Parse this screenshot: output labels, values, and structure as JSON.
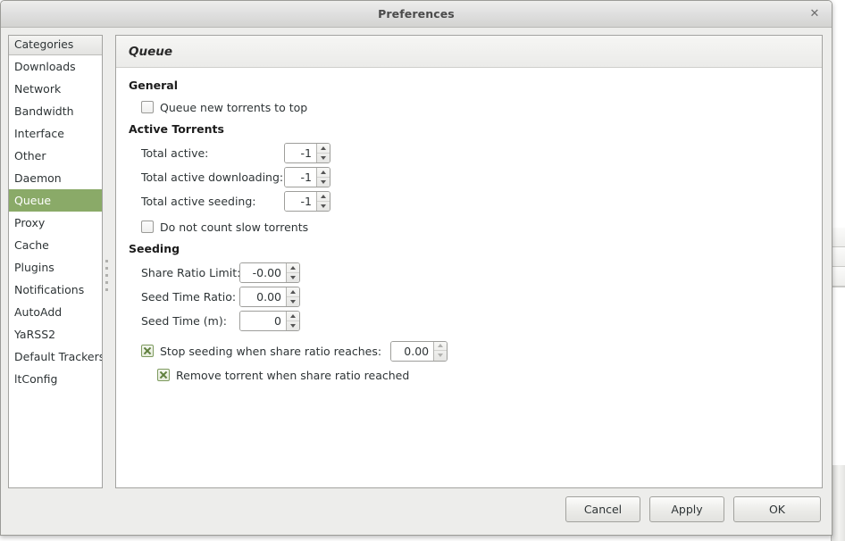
{
  "window": {
    "title": "Preferences",
    "close_label": "✕"
  },
  "sidebar": {
    "header": "Categories",
    "selected": "Queue",
    "accent_color": "#8aaa68",
    "items": [
      {
        "label": "Downloads"
      },
      {
        "label": "Network"
      },
      {
        "label": "Bandwidth"
      },
      {
        "label": "Interface"
      },
      {
        "label": "Other"
      },
      {
        "label": "Daemon"
      },
      {
        "label": "Queue"
      },
      {
        "label": "Proxy"
      },
      {
        "label": "Cache"
      },
      {
        "label": "Plugins"
      },
      {
        "label": "Notifications"
      },
      {
        "label": "AutoAdd"
      },
      {
        "label": "YaRSS2"
      },
      {
        "label": "Default Trackers"
      },
      {
        "label": "ltConfig"
      }
    ]
  },
  "main": {
    "header_title": "Queue",
    "general": {
      "title": "General",
      "queue_new_to_top": {
        "label": "Queue new torrents to top",
        "checked": false
      }
    },
    "active_torrents": {
      "title": "Active Torrents",
      "rows": [
        {
          "label": "Total active:",
          "value": "-1"
        },
        {
          "label": "Total active downloading:",
          "value": "-1"
        },
        {
          "label": "Total active seeding:",
          "value": "-1"
        }
      ],
      "do_not_count_slow": {
        "label": "Do not count slow torrents",
        "checked": false
      }
    },
    "seeding": {
      "title": "Seeding",
      "rows": [
        {
          "label": "Share Ratio Limit:",
          "value": "-0.00"
        },
        {
          "label": "Seed Time Ratio:",
          "value": "0.00"
        },
        {
          "label": "Seed Time (m):",
          "value": "0"
        }
      ],
      "stop_seeding": {
        "label": "Stop seeding when share ratio reaches:",
        "checked": true,
        "value": "0.00"
      },
      "remove_torrent": {
        "label": "Remove torrent when share ratio reached",
        "checked": true
      }
    }
  },
  "footer": {
    "cancel": "Cancel",
    "apply": "Apply",
    "ok": "OK"
  }
}
